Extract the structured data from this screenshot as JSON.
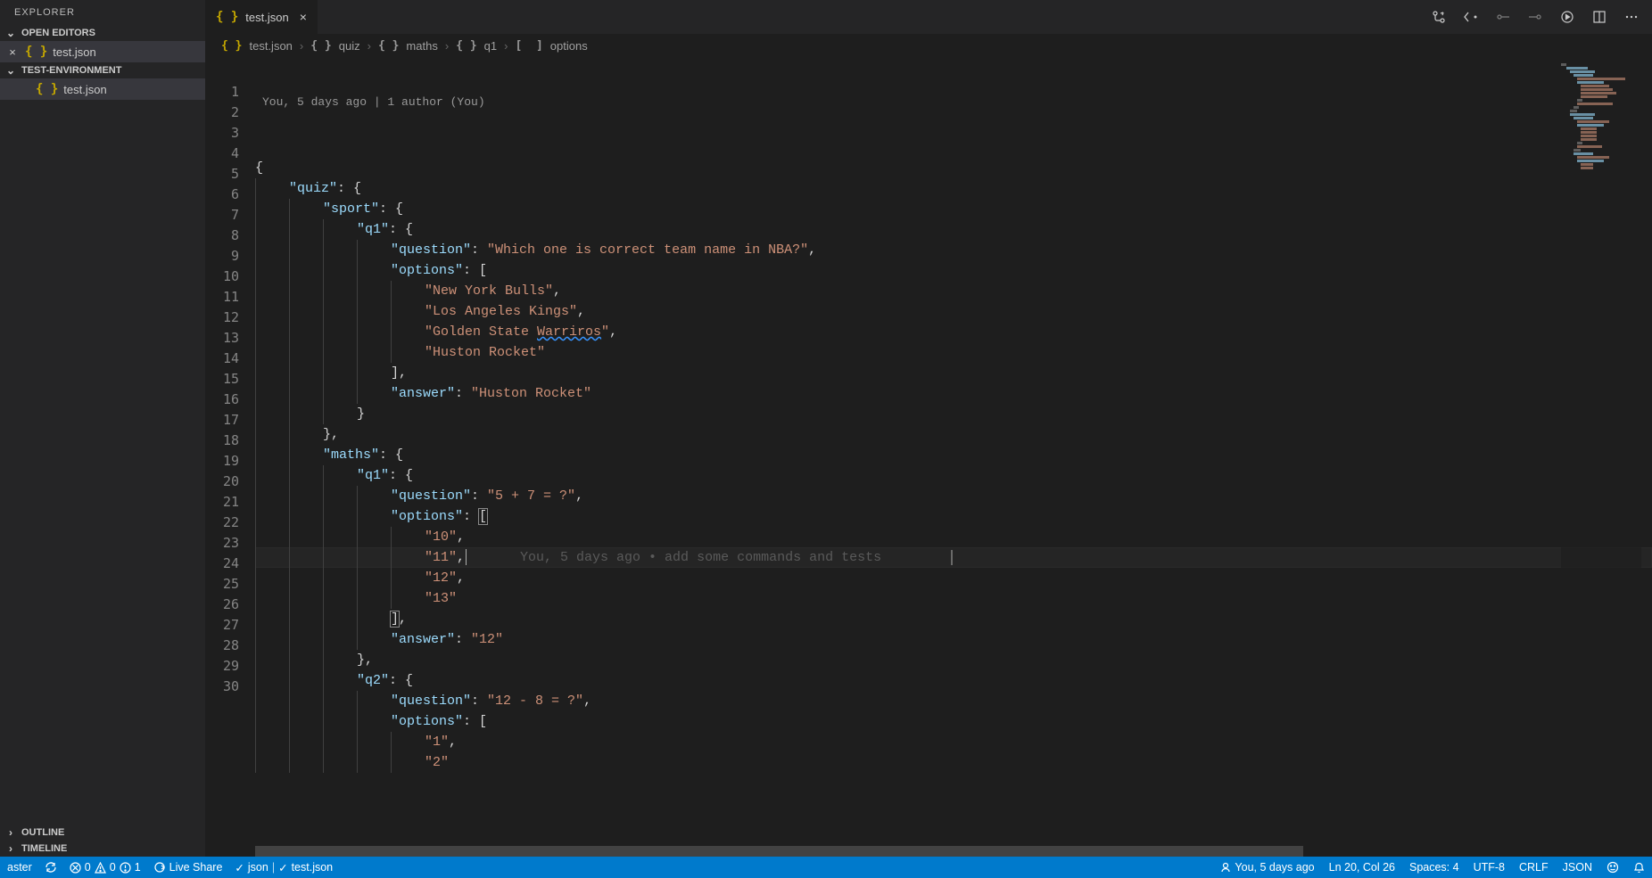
{
  "sidebar": {
    "explorer_label": "EXPLORER",
    "open_editors_label": "OPEN EDITORS",
    "workspace_label": "TEST-ENVIRONMENT",
    "outline_label": "OUTLINE",
    "timeline_label": "TIMELINE",
    "open_editor_file": "test.json",
    "workspace_file": "test.json"
  },
  "tab": {
    "label": "test.json"
  },
  "breadcrumb": {
    "parts": [
      "test.json",
      "quiz",
      "maths",
      "q1",
      "options"
    ]
  },
  "codelens": "You, 5 days ago | 1 author (You)",
  "blame_inline": "You, 5 days ago • add some commands and tests",
  "code": {
    "lines": [
      {
        "n": 1,
        "i": 0,
        "segs": [
          [
            "brace",
            "{"
          ]
        ]
      },
      {
        "n": 2,
        "i": 1,
        "segs": [
          [
            "key",
            "\"quiz\""
          ],
          [
            "punc",
            ": "
          ],
          [
            "brace",
            "{"
          ]
        ]
      },
      {
        "n": 3,
        "i": 2,
        "segs": [
          [
            "key",
            "\"sport\""
          ],
          [
            "punc",
            ": "
          ],
          [
            "brace",
            "{"
          ]
        ]
      },
      {
        "n": 4,
        "i": 3,
        "segs": [
          [
            "key",
            "\"q1\""
          ],
          [
            "punc",
            ": "
          ],
          [
            "brace",
            "{"
          ]
        ]
      },
      {
        "n": 5,
        "i": 4,
        "segs": [
          [
            "key",
            "\"question\""
          ],
          [
            "punc",
            ": "
          ],
          [
            "str",
            "\"Which one is correct team name in NBA?\""
          ],
          [
            "punc",
            ","
          ]
        ]
      },
      {
        "n": 6,
        "i": 4,
        "segs": [
          [
            "key",
            "\"options\""
          ],
          [
            "punc",
            ": "
          ],
          [
            "brace",
            "["
          ]
        ]
      },
      {
        "n": 7,
        "i": 5,
        "segs": [
          [
            "str",
            "\"New York Bulls\""
          ],
          [
            "punc",
            ","
          ]
        ]
      },
      {
        "n": 8,
        "i": 5,
        "segs": [
          [
            "str",
            "\"Los Angeles Kings\""
          ],
          [
            "punc",
            ","
          ]
        ]
      },
      {
        "n": 9,
        "i": 5,
        "segs": [
          [
            "str",
            "\"Golden State "
          ],
          [
            "str-squiggle",
            "Warriros"
          ],
          [
            "str",
            "\""
          ],
          [
            "punc",
            ","
          ]
        ]
      },
      {
        "n": 10,
        "i": 5,
        "segs": [
          [
            "str",
            "\"Huston Rocket\""
          ]
        ]
      },
      {
        "n": 11,
        "i": 4,
        "segs": [
          [
            "brace",
            "]"
          ],
          [
            "punc",
            ","
          ]
        ]
      },
      {
        "n": 12,
        "i": 4,
        "segs": [
          [
            "key",
            "\"answer\""
          ],
          [
            "punc",
            ": "
          ],
          [
            "str",
            "\"Huston Rocket\""
          ]
        ]
      },
      {
        "n": 13,
        "i": 3,
        "segs": [
          [
            "brace",
            "}"
          ]
        ]
      },
      {
        "n": 14,
        "i": 2,
        "segs": [
          [
            "brace",
            "}"
          ],
          [
            "punc",
            ","
          ]
        ]
      },
      {
        "n": 15,
        "i": 2,
        "segs": [
          [
            "key",
            "\"maths\""
          ],
          [
            "punc",
            ": "
          ],
          [
            "brace",
            "{"
          ]
        ]
      },
      {
        "n": 16,
        "i": 3,
        "segs": [
          [
            "key",
            "\"q1\""
          ],
          [
            "punc",
            ": "
          ],
          [
            "brace",
            "{"
          ]
        ]
      },
      {
        "n": 17,
        "i": 4,
        "segs": [
          [
            "key",
            "\"question\""
          ],
          [
            "punc",
            ": "
          ],
          [
            "str",
            "\"5 + 7 = ?\""
          ],
          [
            "punc",
            ","
          ]
        ]
      },
      {
        "n": 18,
        "i": 4,
        "segs": [
          [
            "key",
            "\"options\""
          ],
          [
            "punc",
            ": "
          ],
          [
            "bracket-hl",
            "["
          ]
        ]
      },
      {
        "n": 19,
        "i": 5,
        "segs": [
          [
            "str",
            "\"10\""
          ],
          [
            "punc",
            ","
          ]
        ]
      },
      {
        "n": 20,
        "i": 5,
        "current": true,
        "segs": [
          [
            "str",
            "\"11\""
          ],
          [
            "punc",
            ","
          ]
        ],
        "blame": true,
        "caret": true
      },
      {
        "n": 21,
        "i": 5,
        "segs": [
          [
            "str",
            "\"12\""
          ],
          [
            "punc",
            ","
          ]
        ]
      },
      {
        "n": 22,
        "i": 5,
        "segs": [
          [
            "str",
            "\"13\""
          ]
        ]
      },
      {
        "n": 23,
        "i": 4,
        "segs": [
          [
            "bracket-hl",
            "]"
          ],
          [
            "punc",
            ","
          ]
        ]
      },
      {
        "n": 24,
        "i": 4,
        "segs": [
          [
            "key",
            "\"answer\""
          ],
          [
            "punc",
            ": "
          ],
          [
            "str",
            "\"12\""
          ]
        ]
      },
      {
        "n": 25,
        "i": 3,
        "segs": [
          [
            "brace",
            "}"
          ],
          [
            "punc",
            ","
          ]
        ]
      },
      {
        "n": 26,
        "i": 3,
        "segs": [
          [
            "key",
            "\"q2\""
          ],
          [
            "punc",
            ": "
          ],
          [
            "brace",
            "{"
          ]
        ]
      },
      {
        "n": 27,
        "i": 4,
        "segs": [
          [
            "key",
            "\"question\""
          ],
          [
            "punc",
            ": "
          ],
          [
            "str",
            "\"12 - 8 = ?\""
          ],
          [
            "punc",
            ","
          ]
        ]
      },
      {
        "n": 28,
        "i": 4,
        "segs": [
          [
            "key",
            "\"options\""
          ],
          [
            "punc",
            ": "
          ],
          [
            "brace",
            "["
          ]
        ]
      },
      {
        "n": 29,
        "i": 5,
        "segs": [
          [
            "str",
            "\"1\""
          ],
          [
            "punc",
            ","
          ]
        ]
      },
      {
        "n": 30,
        "i": 5,
        "segs": [
          [
            "str",
            "\"2\""
          ]
        ],
        "cutoff": true
      }
    ]
  },
  "statusbar": {
    "branch": "aster",
    "sync": "",
    "problems": "0  0  1",
    "liveshare": "Live Share",
    "formatter_json": "json",
    "formatter_file": "test.json",
    "blame": "You, 5 days ago",
    "cursor": "Ln 20, Col 26",
    "spaces": "Spaces: 4",
    "encoding": "UTF-8",
    "eol": "CRLF",
    "lang": "JSON"
  }
}
